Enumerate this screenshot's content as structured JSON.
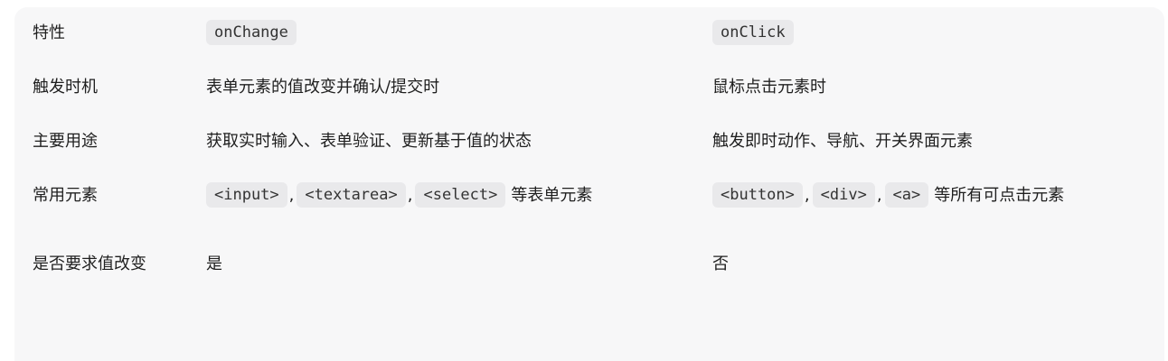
{
  "table": {
    "header": {
      "feature": "特性",
      "a": "onChange",
      "b": "onClick"
    },
    "rows": [
      {
        "label": "触发时机",
        "a": "表单元素的值改变并确认/提交时",
        "b": "鼠标点击元素时"
      },
      {
        "label": "主要用途",
        "a": "获取实时输入、表单验证、更新基于值的状态",
        "b": "触发即时动作、导航、开关界面元素"
      },
      {
        "label": "常用元素",
        "a_codes": [
          "<input>",
          "<textarea>",
          "<select>"
        ],
        "a_suffix": "等表单元素",
        "b_codes": [
          "<button>",
          "<div>",
          "<a>"
        ],
        "b_suffix": "等所有可点击元素"
      },
      {
        "label": "是否要求值改变",
        "a": "是",
        "b": "否"
      }
    ],
    "separator": ","
  }
}
